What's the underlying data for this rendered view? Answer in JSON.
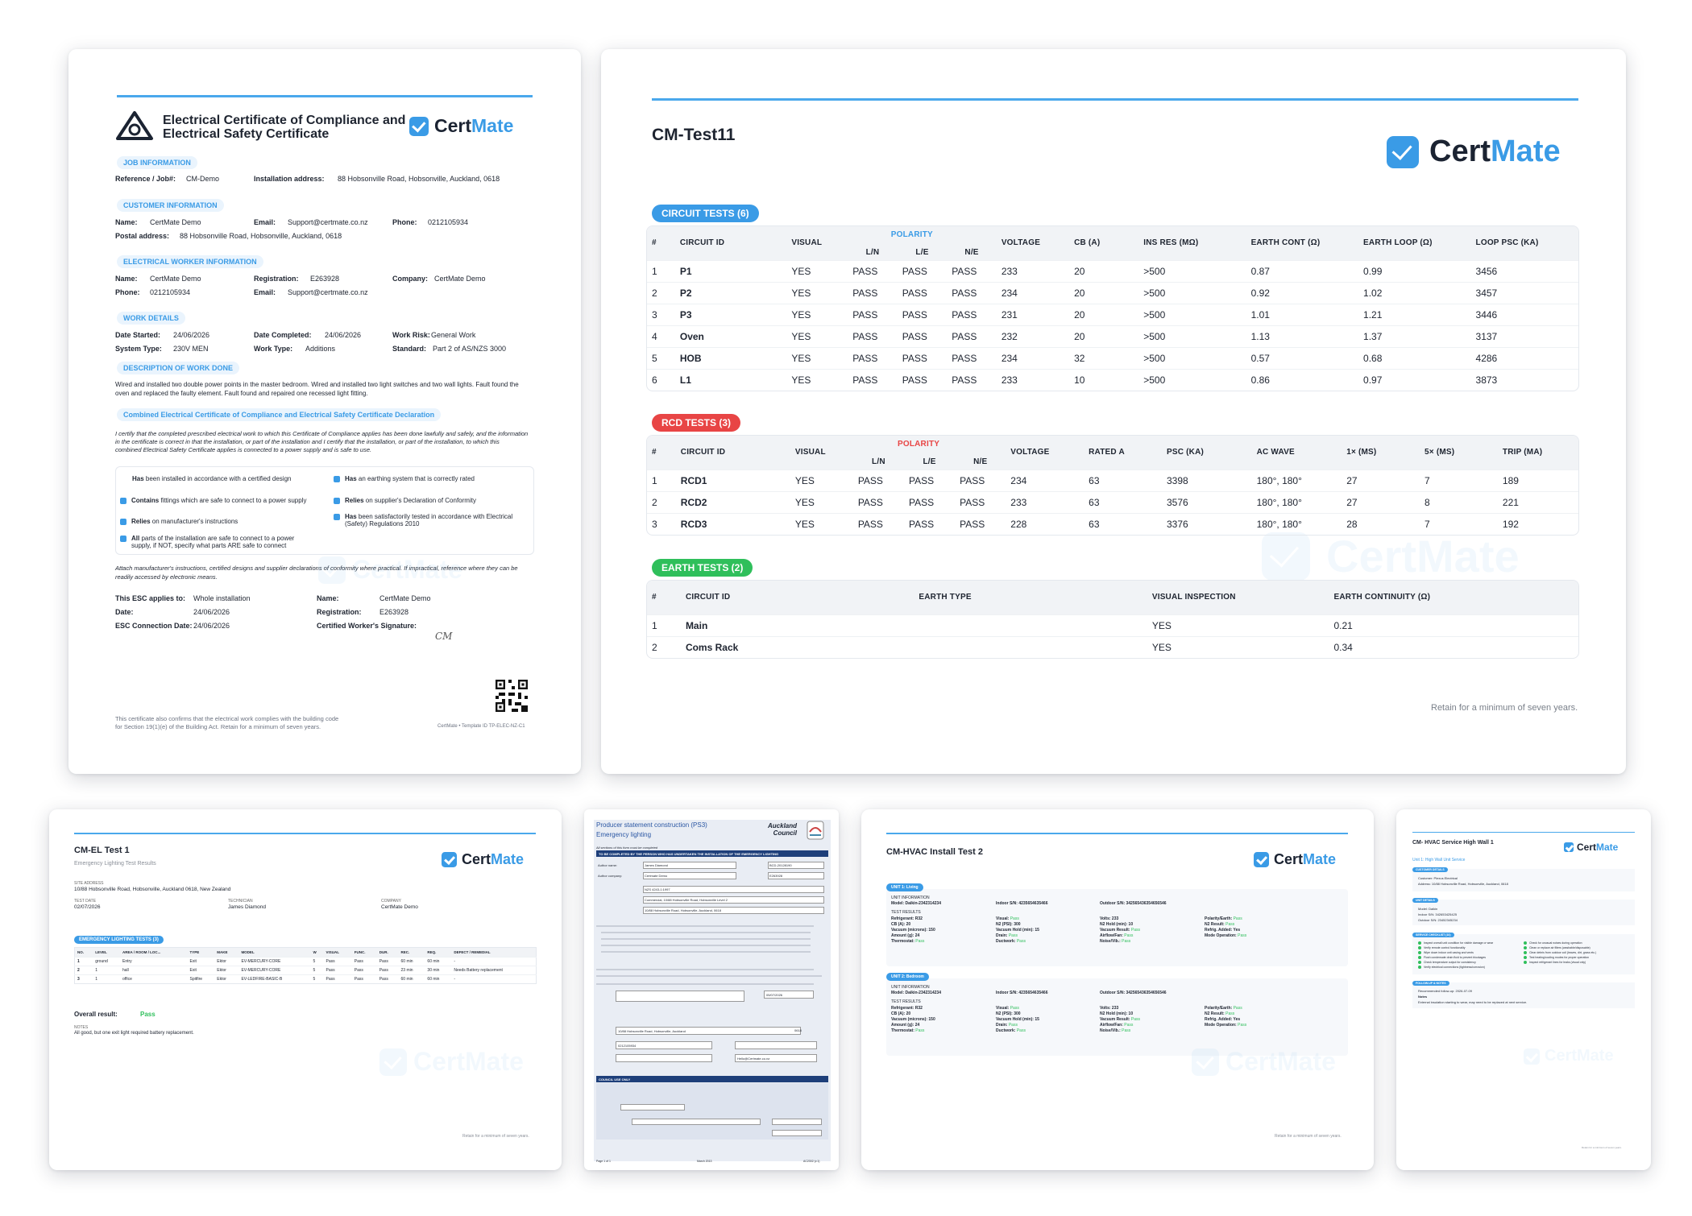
{
  "c1": {
    "title": "Electrical Certificate of Compliance and Electrical Safety Certificate",
    "brand_cert": "Cert",
    "brand_mate": "Mate",
    "job_info": "JOB INFORMATION",
    "ref_label": "Reference / Job#:",
    "ref_value": "CM-Demo",
    "addr_label": "Installation address:",
    "addr_value": "88 Hobsonville Road, Hobsonville, Auckland, 0618",
    "cust_info": "CUSTOMER INFORMATION",
    "name_label": "Name:",
    "cust_name": "CertMate Demo",
    "email_label": "Email:",
    "cust_email": "Support@certmate.co.nz",
    "phone_label": "Phone:",
    "cust_phone": "0212105934",
    "postal_label": "Postal address:",
    "postal_value": "88 Hobsonville Road, Hobsonville, Auckland, 0618",
    "worker_info": "ELECTRICAL WORKER INFORMATION",
    "worker_name": "CertMate Demo",
    "reg_label": "Registration:",
    "reg_value": "E263928",
    "company_label": "Company:",
    "company_value": "CertMate Demo",
    "worker_phone": "0212105934",
    "worker_email": "Support@certmate.co.nz",
    "work_details": "WORK DETAILS",
    "date_started_label": "Date Started:",
    "date_started": "24/06/2026",
    "date_completed_label": "Date Completed:",
    "date_completed": "24/06/2026",
    "risk_label": "Work Risk:",
    "risk_value": "General Work",
    "system_label": "System Type:",
    "system_value": "230V MEN",
    "worktype_label": "Work Type:",
    "worktype_value": "Additions",
    "standard_label": "Standard:",
    "standard_value": "Part 2 of AS/NZS 3000",
    "desc_heading": "DESCRIPTION OF WORK DONE",
    "desc_line1": "Wired and installed two double power points in the master bedroom. Wired and installed two light switches and two wall lights. Fault found the",
    "desc_line2": "oven and replaced the faulty element. Fault found and repaired one recessed light fitting.",
    "decl_heading": "Combined Electrical Certificate of Compliance and Electrical Safety Certificate Declaration",
    "decl_line1": "I certify that the completed prescribed electrical work to which this Certificate of Compliance applies has been done lawfully and safely, and the information",
    "decl_line2": "in the certificate is correct in that the installation, or part of the installation and I certify that the installation, or part of the installation, to which this",
    "decl_line3": "combined Electrical Safety Certificate applies is connected to a power supply and is safe to use.",
    "chk1_b": "Has",
    "chk1": " been installed in accordance with a certified design",
    "chk2_b": "Has",
    "chk2": " an earthing system that is correctly rated",
    "chk3_b": "Contains",
    "chk3": " fittings which are safe to connect to a power supply",
    "chk4_b": "Relies",
    "chk4": " on supplier's Declaration of Conformity",
    "chk5_b": "Relies",
    "chk5": " on manufacturer's instructions",
    "chk6_b": "Has",
    "chk6a": " been satisfactorily tested in accordance with Electrical",
    "chk6b": "(Safety) Regulations 2010",
    "chk7_b": "All",
    "chk7a": " parts of the installation are safe to connect to a power",
    "chk7b": "supply, if NOT, specify what parts ARE safe to connect",
    "attach_line1": "Attach manufacturer's instructions, certified designs and supplier declarations of conformity where practical. If impractical, reference where they can be",
    "attach_line2": "readily accessed by electronic means.",
    "applies_label": "This ESC applies to:",
    "applies_value": "Whole installation",
    "sig_name": "CertMate Demo",
    "date_label": "Date:",
    "date_value": "24/06/2026",
    "sig_reg": "E263928",
    "conn_label": "ESC Connection Date:",
    "conn_value": "24/06/2026",
    "sig_label": "Certified Worker's Signature:",
    "signature": "CM",
    "footer1": "This certificate also confirms that the electrical work complies with the building code",
    "footer2": "for Section 19(1)(e) of the Building Act. Retain for a minimum of seven years.",
    "template_id": "CertMate • Template ID TP-ELEC-NZ-C1"
  },
  "c2": {
    "title": "CM-Test11",
    "circuit_pill": "CIRCUIT TESTS  (6)",
    "circuit_headers": [
      "#",
      "CIRCUIT ID",
      "VISUAL",
      "L/N",
      "L/E",
      "N/E",
      "VOLTAGE",
      "CB (A)",
      "INS RES (MΩ)",
      "EARTH CONT (Ω)",
      "EARTH LOOP (Ω)",
      "LOOP PSC (KA)"
    ],
    "polarity": "POLARITY",
    "circuits": [
      [
        "1",
        "P1",
        "YES",
        "PASS",
        "PASS",
        "PASS",
        "233",
        "20",
        ">500",
        "0.87",
        "0.99",
        "3456"
      ],
      [
        "2",
        "P2",
        "YES",
        "PASS",
        "PASS",
        "PASS",
        "234",
        "20",
        ">500",
        "0.92",
        "1.02",
        "3457"
      ],
      [
        "3",
        "P3",
        "YES",
        "PASS",
        "PASS",
        "PASS",
        "231",
        "20",
        ">500",
        "1.01",
        "1.21",
        "3446"
      ],
      [
        "4",
        "Oven",
        "YES",
        "PASS",
        "PASS",
        "PASS",
        "232",
        "20",
        ">500",
        "1.13",
        "1.37",
        "3137"
      ],
      [
        "5",
        "HOB",
        "YES",
        "PASS",
        "PASS",
        "PASS",
        "234",
        "32",
        ">500",
        "0.57",
        "0.68",
        "4286"
      ],
      [
        "6",
        "L1",
        "YES",
        "PASS",
        "PASS",
        "PASS",
        "233",
        "10",
        ">500",
        "0.86",
        "0.97",
        "3873"
      ]
    ],
    "rcd_pill": "RCD TESTS  (3)",
    "rcd_headers": [
      "#",
      "CIRCUIT ID",
      "VISUAL",
      "L/N",
      "L/E",
      "N/E",
      "VOLTAGE",
      "RATED A",
      "PSC (KA)",
      "AC WAVE",
      "1× (MS)",
      "5× (MS)",
      "TRIP (MA)"
    ],
    "rcds": [
      [
        "1",
        "RCD1",
        "YES",
        "PASS",
        "PASS",
        "PASS",
        "234",
        "63",
        "3398",
        "180°, 180°",
        "27",
        "7",
        "189"
      ],
      [
        "2",
        "RCD2",
        "YES",
        "PASS",
        "PASS",
        "PASS",
        "233",
        "63",
        "3576",
        "180°, 180°",
        "27",
        "8",
        "221"
      ],
      [
        "3",
        "RCD3",
        "YES",
        "PASS",
        "PASS",
        "PASS",
        "228",
        "63",
        "3376",
        "180°, 180°",
        "28",
        "7",
        "192"
      ]
    ],
    "earth_pill": "EARTH TESTS  (2)",
    "earth_headers": [
      "#",
      "CIRCUIT ID",
      "EARTH TYPE",
      "VISUAL INSPECTION",
      "EARTH CONTINUITY (Ω)"
    ],
    "earths": [
      [
        "1",
        "Main",
        "",
        "YES",
        "0.21"
      ],
      [
        "2",
        "Coms Rack",
        "",
        "YES",
        "0.34"
      ]
    ],
    "retain": "Retain for a minimum of seven years."
  },
  "c3": {
    "title": "CM-EL Test 1",
    "subtitle": "Emergency Lighting Test Results",
    "site_label": "SITE ADDRESS",
    "site_value": "10/88 Hobsonville Road, Hobsonville, Auckland 0618, New Zealand",
    "date_label": "TEST DATE",
    "date_value": "02/07/2026",
    "tech_label": "TECHNICIAN",
    "tech_value": "James Diamond",
    "comp_label": "COMPANY",
    "comp_value": "CertMate Demo",
    "pill": "EMERGENCY LIGHTING TESTS (3)",
    "headers": [
      "NO.",
      "LEVEL",
      "AREA / ROOM / LOC...",
      "TYPE",
      "MAKE",
      "MODEL",
      "W",
      "VISUAL",
      "FUNC.",
      "DUR.",
      "REC.",
      "REQ.",
      "DEFECT / REMEDIAL"
    ],
    "rows": [
      [
        "1",
        "ground",
        "Entry",
        "Exit",
        "Ektor",
        "EV-MERCURY-CORE",
        "5",
        "Pass",
        "Pass",
        "Pass",
        "60 min",
        "60 min",
        "-"
      ],
      [
        "2",
        "1",
        "hall",
        "Exit",
        "Ektor",
        "EV-MERCURY-CORE",
        "5",
        "Pass",
        "Pass",
        "Pass",
        "23 min",
        "30 min",
        "Needs Battery replacement"
      ],
      [
        "3",
        "1",
        "office",
        "Spitfire",
        "Ektor",
        "EV-LEDFIRE-BASIC-B",
        "5",
        "Pass",
        "Pass",
        "Pass",
        "60 min",
        "60 min",
        "-"
      ]
    ],
    "overall_label": "Overall result:",
    "overall_value": "Pass",
    "notes_label": "NOTES",
    "notes_value": "All good, but one exit light required battery replacement.",
    "retain": "Retain for a minimum of seven years."
  },
  "c4": {
    "title1": "Producer statement construction (PS3)",
    "title2": "Emergency lighting",
    "council1": "Auckland",
    "council2": "Council",
    "note": "All sections of this form must be completed",
    "bar1": "TO BE COMPLETED BY THE PERSON WHO HAS UNDERTAKEN THE INSTALLATION OF THE EMERGENCY LIGHTING",
    "author_name": "James Diamond",
    "author_company": "Certmate Demo",
    "consent_no": "BCD-20128190",
    "reg_no": "E263928",
    "perf": "NZS 4243-1:1997",
    "legal": "Commercial, 10/88 Hobsonville Road, Hobsonville Level 2",
    "site": "10/88 Hobsonville Road, Hobsonville, Auckland, 0618",
    "date": "05/07/2026",
    "address": "10/88 Hobsonville Road, Hobsonville, Auckland",
    "postcode": "0618",
    "business": "0212105934",
    "email": "Hello@Certmate.co.nz",
    "bar2": "COUNCIL USE ONLY",
    "footer_left": "Page 1 of 1",
    "footer_mid": "March 2013",
    "footer_right": "AC2302 (v.1)"
  },
  "c5": {
    "title": "CM-HVAC Install Test 2",
    "unit1": "UNIT 1: Living",
    "unit2": "UNIT 2: Bedroom",
    "unit_info": "UNIT INFORMATION",
    "test_results": "TEST RESULTS",
    "model": "Model:  Daikin-2342314234",
    "indoor": "Indoor S/N:  4235654635466",
    "outdoor": "Outdoor S/N:  342565436354656546",
    "refrigerant": "Refrigerant:  R32",
    "cb": "CB (A):  20",
    "vacuum": "Vacuum (microns):  150",
    "amount": "Amount (g):  24",
    "thermostat": "Thermostat:",
    "visual": "Visual:",
    "n2": "N2 (PSI):  300",
    "vacuum_hold": "Vacuum Hold (min):  15",
    "drain": "Drain:",
    "ductwork": "Ductwork:",
    "volts": "Volts:  233",
    "n2_hold": "N2 Hold (min):  10",
    "vac_result": "Vacuum Result:",
    "airflow": "Airflow/Fan:",
    "noise": "Noise/Vib.:",
    "polarity": "Polarity/Earth:",
    "n2_result": "N2 Result:",
    "refrig_added": "Refrig. Added:  Yes",
    "mode": "Mode Operation:",
    "pass": "Pass",
    "retain": "Retain for a minimum of seven years."
  },
  "c6": {
    "title": "CM- HVAC Service High Wall 1",
    "unit": "Unit 1: High Wall Unit Service",
    "cust_details": "CUSTOMER DETAILS",
    "customer": "Customer:  Plexus Electrical",
    "address": "Address:  10/88 Hobsonville Road, Hobsonville, Auckland, 0618",
    "unit_details": "UNIT DETAILS",
    "model": "Model:  Daikin",
    "indoor": "Indoor S/N:  342653425425",
    "outdoor": "Outdoor S/N:  23452345234",
    "checklist": "SERVICE CHECKLIST (10)",
    "checks_left": [
      "Inspect overall unit condition for visible damage or wear",
      "Verify remote control functionality",
      "Wipe down indoor unit casing and vents",
      "Flush condensate drain fluid to prevent blockages",
      "Check temperature output for consistency",
      "Verify electrical connections (tightness/corrosion)"
    ],
    "checks_right": [
      "Check for unusual noises during operation",
      "Clean or replace air filters (washable/disposable)",
      "Clear debris from outdoor coil (leaves, dirt, grass etc.)",
      "Test heating/cooling modes for proper operation",
      "Inspect refrigerant lines for leaks (visual only)"
    ],
    "followup": "FOLLOW-UP & NOTES",
    "followup_date": "Recommended follow-up:  2026-07-09",
    "notes_label": "Notes",
    "notes": "External insulation starting to wear, may need to be replaced at next service.",
    "retain": "Retain for a minimum of seven years."
  },
  "colors": {
    "accent": "#3a9be6",
    "rcd": "#e84545",
    "earth": "#2fbf5b",
    "pass": "#2fbf5b"
  }
}
